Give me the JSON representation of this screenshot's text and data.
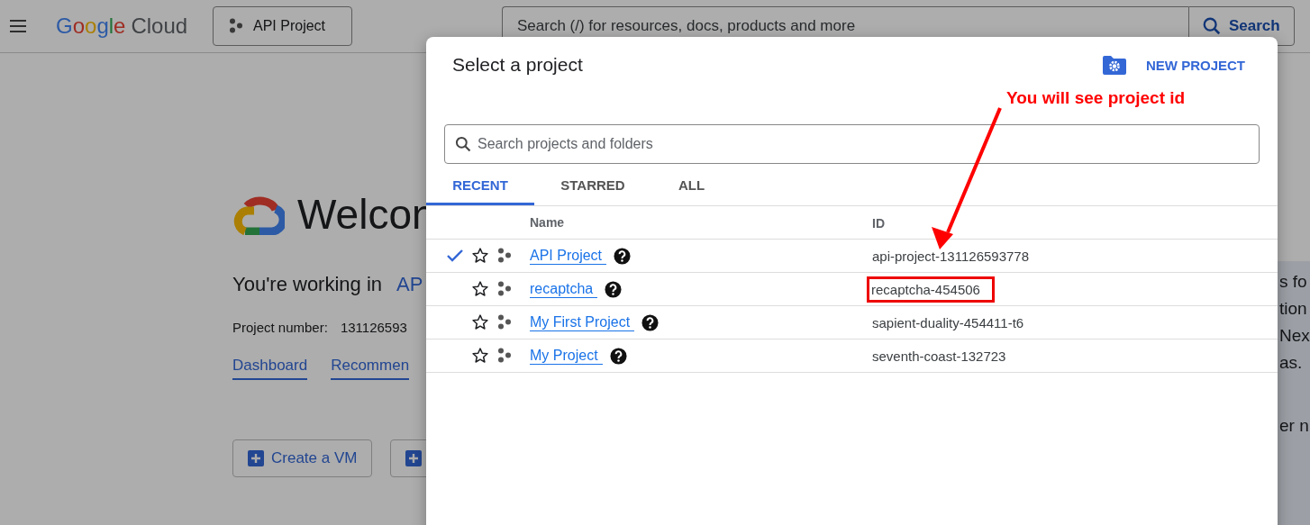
{
  "header": {
    "logo": {
      "brand": "Google",
      "product": "Cloud"
    },
    "project_button": "API Project",
    "search": {
      "placeholder": "Search (/) for resources, docs, products and more"
    },
    "search_button": "Search"
  },
  "welcome": {
    "title": "Welcon",
    "working_in": "You're working in",
    "working_project": "AP",
    "project_number_label": "Project number:",
    "project_number": "131126593",
    "links": [
      "Dashboard",
      "Recommen"
    ],
    "buttons": [
      {
        "kind": "labeled",
        "label": "Create a VM"
      },
      {
        "kind": "icon"
      }
    ]
  },
  "side_panel": {
    "lines": [
      "s fo",
      "tion",
      "Nex",
      "as.",
      "er n"
    ]
  },
  "dialog": {
    "title": "Select a project",
    "new_project": "NEW PROJECT",
    "search": {
      "placeholder": "Search projects and folders"
    },
    "tabs": [
      {
        "label": "RECENT",
        "selected": true
      },
      {
        "label": "STARRED",
        "selected": false
      },
      {
        "label": "ALL",
        "selected": false
      }
    ],
    "columns": [
      "Name",
      "ID"
    ],
    "rows": [
      {
        "name": "API Project",
        "id": "api-project-131126593778",
        "current": true,
        "starred": false,
        "highlighted": false
      },
      {
        "name": "recaptcha",
        "id": "recaptcha-454506",
        "current": false,
        "starred": false,
        "highlighted": true
      },
      {
        "name": "My First Project",
        "id": "sapient-duality-454411-t6",
        "current": false,
        "starred": false,
        "highlighted": false
      },
      {
        "name": "My Project",
        "id": "seventh-coast-132723",
        "current": false,
        "starred": false,
        "highlighted": false
      }
    ]
  },
  "annotation": {
    "label": "You will see project id"
  }
}
